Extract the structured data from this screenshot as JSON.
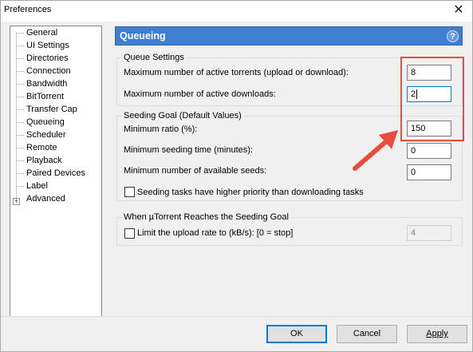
{
  "window": {
    "title": "Preferences"
  },
  "sidebar": {
    "items": [
      {
        "label": "General"
      },
      {
        "label": "UI Settings"
      },
      {
        "label": "Directories"
      },
      {
        "label": "Connection"
      },
      {
        "label": "Bandwidth"
      },
      {
        "label": "BitTorrent"
      },
      {
        "label": "Transfer Cap"
      },
      {
        "label": "Queueing",
        "selected": true
      },
      {
        "label": "Scheduler"
      },
      {
        "label": "Remote"
      },
      {
        "label": "Playback"
      },
      {
        "label": "Paired Devices"
      },
      {
        "label": "Label"
      },
      {
        "label": "Advanced",
        "expandable": true
      }
    ]
  },
  "panel": {
    "title": "Queueing",
    "help_glyph": "?"
  },
  "queue_settings": {
    "legend": "Queue Settings",
    "max_active_torrents_label": "Maximum number of active torrents (upload or download):",
    "max_active_torrents_value": "8",
    "max_active_downloads_label": "Maximum number of active downloads:",
    "max_active_downloads_value": "2"
  },
  "seeding_goal": {
    "legend": "Seeding Goal (Default Values)",
    "min_ratio_label": "Minimum ratio (%):",
    "min_ratio_value": "150",
    "min_seed_time_label": "Minimum seeding time (minutes):",
    "min_seed_time_value": "0",
    "min_seeds_label": "Minimum number of available seeds:",
    "min_seeds_value": "0",
    "priority_checkbox_label": "Seeding tasks have higher priority than downloading tasks",
    "priority_checked": false
  },
  "reached_goal": {
    "legend": "When µTorrent Reaches the Seeding Goal",
    "limit_checkbox_label": "Limit the upload rate to (kB/s): [0 = stop]",
    "limit_checked": false,
    "limit_value": "4"
  },
  "buttons": {
    "ok": "OK",
    "cancel": "Cancel",
    "apply": "Apply"
  },
  "colors": {
    "accent": "#3f7ed1",
    "highlight": "#e74c3c"
  }
}
